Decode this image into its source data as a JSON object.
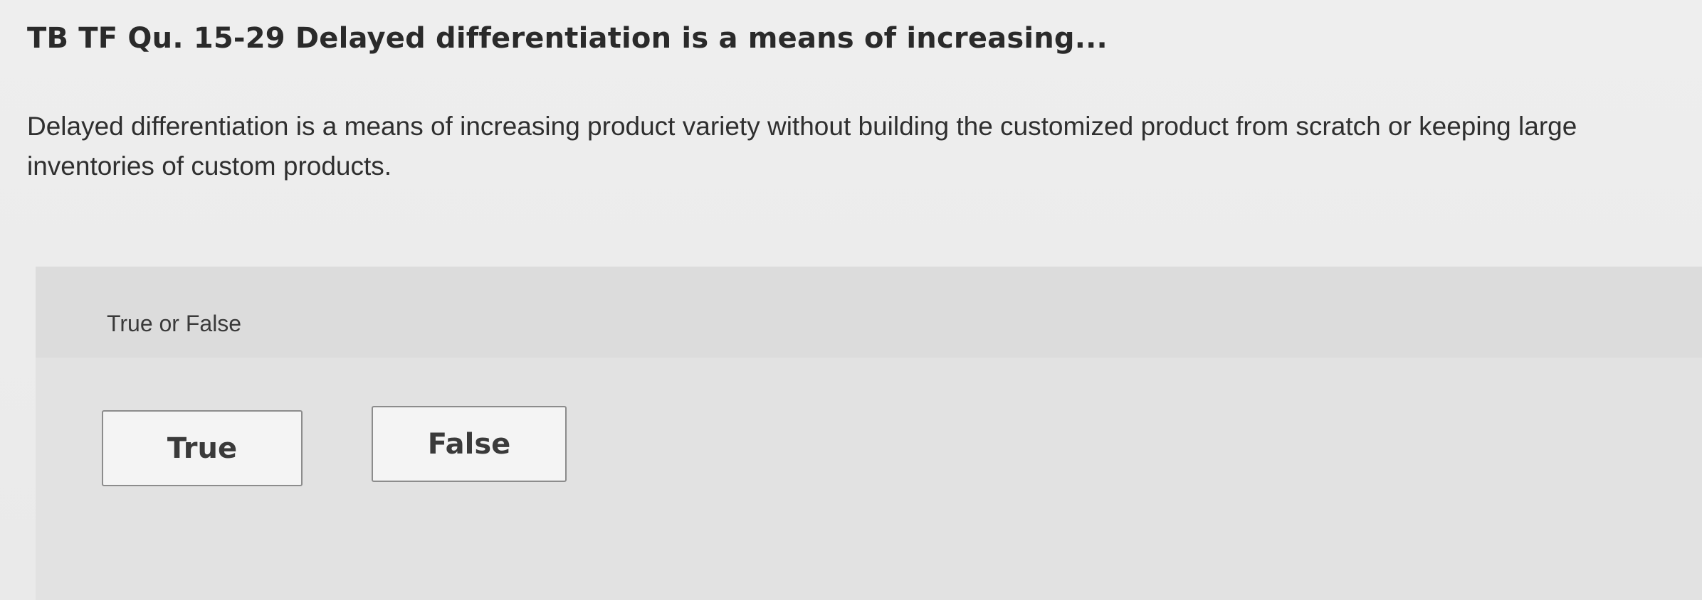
{
  "header": {
    "title": "TB TF Qu. 15-29 Delayed differentiation is a means of increasing..."
  },
  "question": {
    "text": "Delayed differentiation is a means of increasing product variety without building the customized product from scratch or keeping large inventories of custom products."
  },
  "answer_panel": {
    "label": "True or False",
    "options": [
      {
        "label": "True"
      },
      {
        "label": "False"
      }
    ]
  }
}
